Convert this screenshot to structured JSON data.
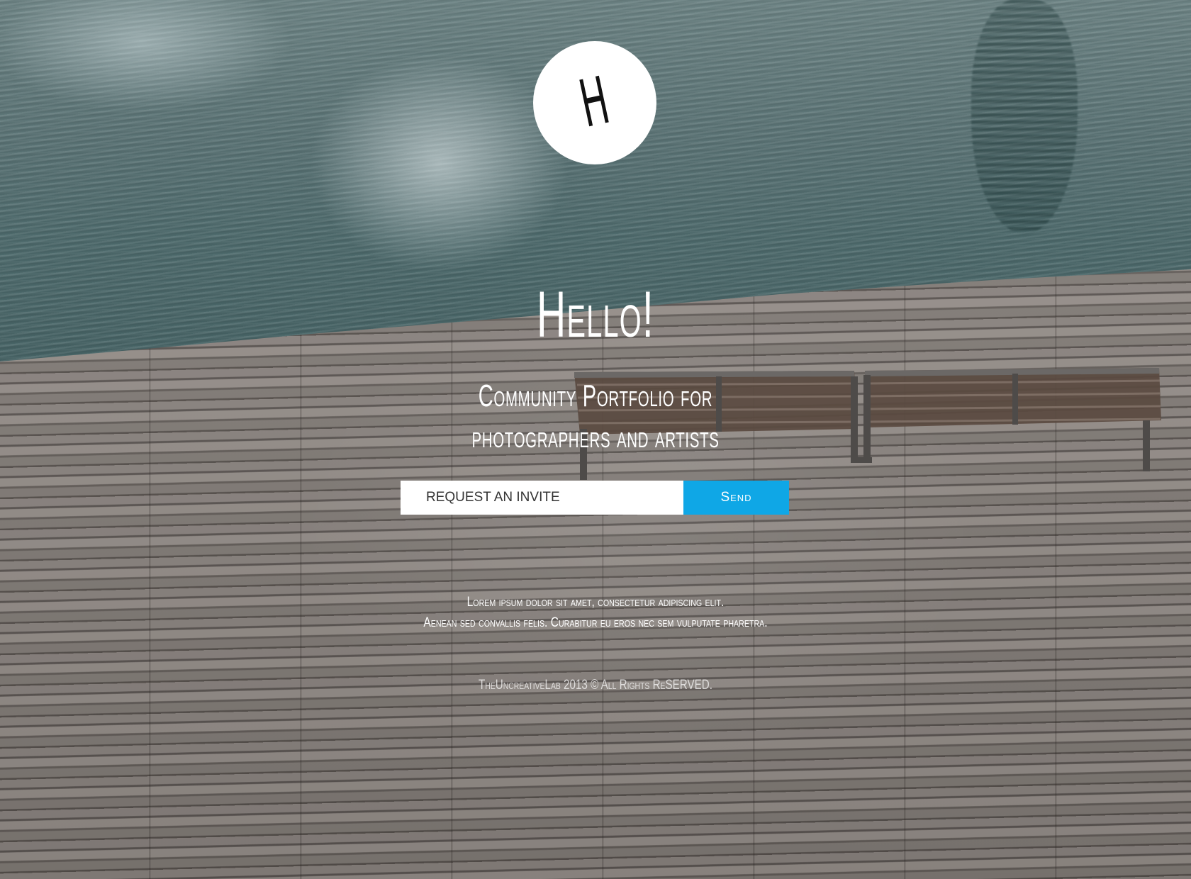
{
  "brand": {
    "logo_letter": "H"
  },
  "hero": {
    "title": "Hello!",
    "subtitle_line1": "Community Portfolio for",
    "subtitle_line2": "photographers and artists"
  },
  "invite": {
    "placeholder": "REQUEST AN INVITE",
    "send_label": "Send"
  },
  "description": {
    "line1": "Lorem ipsum dolor sit amet, consectetur adipiscing elit.",
    "line2": "Aenean sed convallis felis. Curabitur eu eros nec sem vulputate pharetra."
  },
  "footer": {
    "copyright": "TheUncreativeLab 2013 © All Rights ReSERVED."
  },
  "colors": {
    "accent": "#0fa7e6",
    "text": "#ffffff",
    "logo_bg": "#ffffff"
  }
}
